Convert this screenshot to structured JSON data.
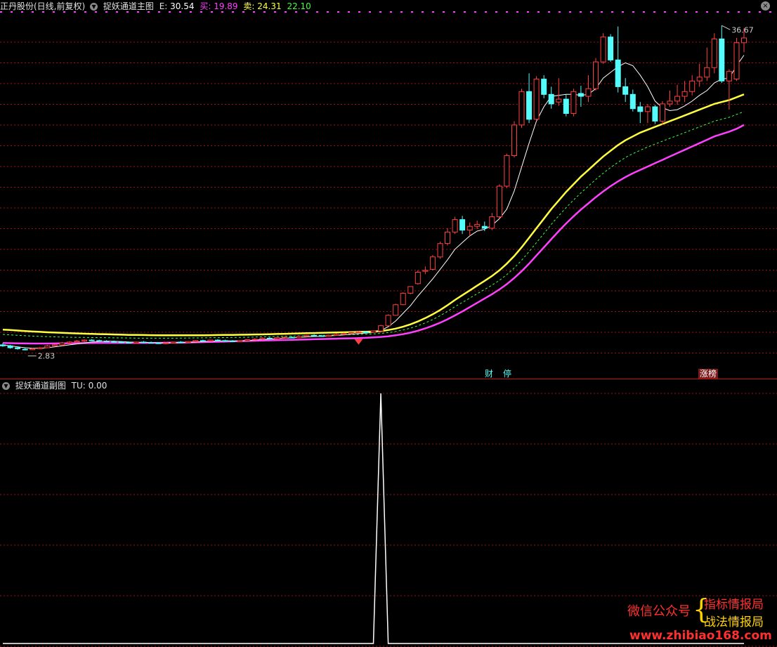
{
  "main_header": {
    "stock_title": "正丹股份(日线,前复权)",
    "indicator_name": "捉妖通道主图",
    "e_label": "E:",
    "e_value": "30.54",
    "buy_label": "买:",
    "buy_value": "19.89",
    "sell_label": "卖:",
    "sell_value": "24.31",
    "extra_value": "22.10"
  },
  "sub_header": {
    "indicator_name": "捉妖通道副图",
    "tu_label": "TU:",
    "tu_value": "0.00"
  },
  "markers": {
    "high_label": "36.67",
    "low_label": "2.83",
    "badge_cai": "财",
    "badge_ting": "停",
    "badge_zhangbang": "涨榜"
  },
  "watermark": {
    "wechat": "微信公众号",
    "line1": "指标情报局",
    "line2": "战法情报局",
    "url": "www.zhibiao168.com"
  },
  "colors": {
    "up": "#ff4040",
    "down": "#54fcfc",
    "ma_yellow": "#ffff40",
    "ma_magenta": "#ff40ff",
    "ma_green": "#40ff40",
    "grid": "#a01010",
    "e_color": "#ffffff",
    "buy_color": "#ff40ff",
    "sell_color": "#ffff40",
    "extra_color": "#40ff40"
  },
  "chart_data": [
    {
      "type": "candlestick",
      "ylim": [
        2.0,
        38.0
      ],
      "candles": [
        [
          3.4,
          3.6,
          3.2,
          3.3
        ],
        [
          3.3,
          3.4,
          3.0,
          3.1
        ],
        [
          3.1,
          3.2,
          2.9,
          3.0
        ],
        [
          2.95,
          3.05,
          2.83,
          2.9
        ],
        [
          2.9,
          3.1,
          2.85,
          3.0
        ],
        [
          3.0,
          3.2,
          2.95,
          3.1
        ],
        [
          3.1,
          3.4,
          3.05,
          3.3
        ],
        [
          3.3,
          3.5,
          3.2,
          3.4
        ],
        [
          3.4,
          3.7,
          3.3,
          3.6
        ],
        [
          3.6,
          3.8,
          3.5,
          3.7
        ],
        [
          3.7,
          3.9,
          3.6,
          3.8
        ],
        [
          3.8,
          4.0,
          3.7,
          3.9
        ],
        [
          3.9,
          4.0,
          3.8,
          3.85
        ],
        [
          3.85,
          3.95,
          3.75,
          3.8
        ],
        [
          3.8,
          3.9,
          3.7,
          3.75
        ],
        [
          3.75,
          3.85,
          3.65,
          3.7
        ],
        [
          3.7,
          3.8,
          3.6,
          3.65
        ],
        [
          3.65,
          3.75,
          3.55,
          3.6
        ],
        [
          3.6,
          3.75,
          3.55,
          3.7
        ],
        [
          3.7,
          3.8,
          3.6,
          3.65
        ],
        [
          3.65,
          3.75,
          3.55,
          3.6
        ],
        [
          3.6,
          3.7,
          3.5,
          3.55
        ],
        [
          3.55,
          3.65,
          3.45,
          3.6
        ],
        [
          3.6,
          3.75,
          3.55,
          3.7
        ],
        [
          3.7,
          3.8,
          3.6,
          3.65
        ],
        [
          3.65,
          3.8,
          3.6,
          3.75
        ],
        [
          3.75,
          3.9,
          3.7,
          3.85
        ],
        [
          3.85,
          3.95,
          3.75,
          3.8
        ],
        [
          3.8,
          3.95,
          3.75,
          3.9
        ],
        [
          3.9,
          4.0,
          3.8,
          3.85
        ],
        [
          3.85,
          3.95,
          3.75,
          3.8
        ],
        [
          3.8,
          3.9,
          3.7,
          3.75
        ],
        [
          3.75,
          3.9,
          3.7,
          3.85
        ],
        [
          3.85,
          4.0,
          3.8,
          3.95
        ],
        [
          3.95,
          4.1,
          3.9,
          4.0
        ],
        [
          4.0,
          4.2,
          3.95,
          4.1
        ],
        [
          4.1,
          4.2,
          4.0,
          4.05
        ],
        [
          4.05,
          4.2,
          4.0,
          4.15
        ],
        [
          4.15,
          4.3,
          4.1,
          4.2
        ],
        [
          4.2,
          4.3,
          4.1,
          4.15
        ],
        [
          4.15,
          4.35,
          4.1,
          4.3
        ],
        [
          4.3,
          4.45,
          4.25,
          4.4
        ],
        [
          4.4,
          4.5,
          4.3,
          4.35
        ],
        [
          4.35,
          4.45,
          4.25,
          4.3
        ],
        [
          4.3,
          4.45,
          4.25,
          4.4
        ],
        [
          4.4,
          4.6,
          4.35,
          4.5
        ],
        [
          4.5,
          4.7,
          4.45,
          4.6
        ],
        [
          4.6,
          4.75,
          4.55,
          4.7
        ],
        [
          4.7,
          4.85,
          4.6,
          4.75
        ],
        [
          4.75,
          4.85,
          4.6,
          4.7
        ],
        [
          4.7,
          4.9,
          4.65,
          4.85
        ],
        [
          4.85,
          5.5,
          4.8,
          5.4
        ],
        [
          5.4,
          6.6,
          5.35,
          6.5
        ],
        [
          6.5,
          7.7,
          6.45,
          7.6
        ],
        [
          7.6,
          8.9,
          7.55,
          8.8
        ],
        [
          8.8,
          9.5,
          8.7,
          9.5
        ],
        [
          9.8,
          11.2,
          9.7,
          11.0
        ],
        [
          11.1,
          11.6,
          10.8,
          11.2
        ],
        [
          11.3,
          12.8,
          11.2,
          12.6
        ],
        [
          12.6,
          14.2,
          12.4,
          14.0
        ],
        [
          14.0,
          15.6,
          13.8,
          15.2
        ],
        [
          15.2,
          16.8,
          15.0,
          16.5
        ],
        [
          16.5,
          16.9,
          15.0,
          15.4
        ],
        [
          15.4,
          16.2,
          14.8,
          15.8
        ],
        [
          15.8,
          16.4,
          15.5,
          16.0
        ],
        [
          15.8,
          16.3,
          15.3,
          15.6
        ],
        [
          15.6,
          17.2,
          15.4,
          16.8
        ],
        [
          16.8,
          20.2,
          16.6,
          20.0
        ],
        [
          20.0,
          23.4,
          19.8,
          23.2
        ],
        [
          23.2,
          26.8,
          23.0,
          26.4
        ],
        [
          26.4,
          30.2,
          26.1,
          29.9
        ],
        [
          29.9,
          31.8,
          26.6,
          27.0
        ],
        [
          27.0,
          31.5,
          26.8,
          31.2
        ],
        [
          31.2,
          31.6,
          29.2,
          29.6
        ],
        [
          29.6,
          30.4,
          28.1,
          28.6
        ],
        [
          28.8,
          31.3,
          28.4,
          29.1
        ],
        [
          29.1,
          29.6,
          27.3,
          27.6
        ],
        [
          27.6,
          30.2,
          27.3,
          29.9
        ],
        [
          29.7,
          30.5,
          28.3,
          29.4
        ],
        [
          29.4,
          31.6,
          28.8,
          30.2
        ],
        [
          30.2,
          33.4,
          30.0,
          33.0
        ],
        [
          33.0,
          36.0,
          32.8,
          35.6
        ],
        [
          35.6,
          35.9,
          33.0,
          33.2
        ],
        [
          33.2,
          36.7,
          29.8,
          30.4
        ],
        [
          30.4,
          31.3,
          28.8,
          29.6
        ],
        [
          29.6,
          30.1,
          27.8,
          28.1
        ],
        [
          28.3,
          28.8,
          26.6,
          27.8
        ],
        [
          27.8,
          28.6,
          26.6,
          28.3
        ],
        [
          28.3,
          28.5,
          26.5,
          26.8
        ],
        [
          26.8,
          28.9,
          26.4,
          28.6
        ],
        [
          28.6,
          30.0,
          28.3,
          28.9
        ],
        [
          28.9,
          30.6,
          28.5,
          29.4
        ],
        [
          29.4,
          31.0,
          28.8,
          29.9
        ],
        [
          29.9,
          31.6,
          29.5,
          31.0
        ],
        [
          31.0,
          32.8,
          30.4,
          31.4
        ],
        [
          31.4,
          34.5,
          31.0,
          32.4
        ],
        [
          32.4,
          36.0,
          31.8,
          35.4
        ],
        [
          35.4,
          36.8,
          30.8,
          31.0
        ],
        [
          31.0,
          32.2,
          28.0,
          32.0
        ],
        [
          31.2,
          35.5,
          31.0,
          35.0
        ],
        [
          35.0,
          36.5,
          34.0,
          35.5
        ]
      ],
      "ma_fast": [
        3.4,
        3.3,
        3.2,
        3.1,
        3.05,
        3.05,
        3.1,
        3.2,
        3.3,
        3.4,
        3.5,
        3.6,
        3.7,
        3.75,
        3.78,
        3.78,
        3.74,
        3.7,
        3.68,
        3.66,
        3.64,
        3.62,
        3.61,
        3.62,
        3.64,
        3.66,
        3.7,
        3.74,
        3.78,
        3.81,
        3.82,
        3.82,
        3.83,
        3.86,
        3.9,
        3.96,
        4.0,
        4.05,
        4.1,
        4.14,
        4.18,
        4.23,
        4.28,
        4.31,
        4.34,
        4.39,
        4.45,
        4.52,
        4.58,
        4.64,
        4.7,
        4.9,
        5.3,
        5.9,
        6.7,
        7.5,
        8.5,
        9.4,
        10.3,
        11.3,
        12.3,
        13.4,
        14.1,
        14.8,
        15.3,
        15.5,
        15.9,
        16.6,
        17.6,
        19.5,
        22.0,
        24.5,
        26.8,
        28.3,
        29.4,
        29.5,
        29.6,
        29.6,
        29.5,
        29.6,
        30.2,
        31.3,
        31.9,
        32.5,
        32.9,
        32.6,
        31.6,
        30.4,
        28.9,
        28.2,
        27.9,
        28.0,
        28.4,
        28.9,
        29.5,
        30.0,
        30.8,
        31.2,
        31.3,
        32.6,
        33.7
      ],
      "ma_yellow": [
        5.0,
        4.95,
        4.9,
        4.85,
        4.8,
        4.76,
        4.72,
        4.69,
        4.66,
        4.63,
        4.6,
        4.57,
        4.55,
        4.53,
        4.51,
        4.49,
        4.47,
        4.45,
        4.44,
        4.43,
        4.42,
        4.41,
        4.4,
        4.4,
        4.4,
        4.4,
        4.4,
        4.41,
        4.42,
        4.43,
        4.44,
        4.45,
        4.46,
        4.47,
        4.49,
        4.5,
        4.52,
        4.54,
        4.56,
        4.58,
        4.6,
        4.62,
        4.64,
        4.66,
        4.68,
        4.7,
        4.72,
        4.74,
        4.76,
        4.78,
        4.8,
        4.85,
        4.95,
        5.1,
        5.3,
        5.55,
        5.85,
        6.2,
        6.6,
        7.05,
        7.55,
        8.1,
        8.6,
        9.1,
        9.6,
        10.1,
        10.6,
        11.2,
        11.9,
        12.7,
        13.6,
        14.6,
        15.6,
        16.6,
        17.6,
        18.5,
        19.4,
        20.2,
        21.0,
        21.7,
        22.4,
        23.1,
        23.7,
        24.3,
        24.8,
        25.2,
        25.6,
        25.9,
        26.2,
        26.5,
        26.8,
        27.1,
        27.4,
        27.7,
        28.0,
        28.3,
        28.6,
        28.8,
        29.0,
        29.3,
        29.6
      ],
      "ma_green": [
        4.5,
        4.45,
        4.4,
        4.36,
        4.32,
        4.29,
        4.26,
        4.24,
        4.22,
        4.2,
        4.19,
        4.18,
        4.17,
        4.16,
        4.15,
        4.14,
        4.13,
        4.12,
        4.11,
        4.1,
        4.1,
        4.1,
        4.1,
        4.1,
        4.11,
        4.12,
        4.13,
        4.14,
        4.15,
        4.16,
        4.17,
        4.18,
        4.19,
        4.2,
        4.22,
        4.24,
        4.26,
        4.28,
        4.3,
        4.32,
        4.34,
        4.36,
        4.38,
        4.4,
        4.42,
        4.44,
        4.46,
        4.48,
        4.5,
        4.52,
        4.55,
        4.6,
        4.68,
        4.8,
        4.95,
        5.15,
        5.4,
        5.7,
        6.05,
        6.45,
        6.9,
        7.4,
        7.85,
        8.3,
        8.75,
        9.2,
        9.65,
        10.15,
        10.75,
        11.45,
        12.25,
        13.15,
        14.1,
        15.05,
        16.0,
        16.9,
        17.75,
        18.55,
        19.3,
        20.0,
        20.7,
        21.35,
        21.95,
        22.5,
        23.0,
        23.4,
        23.75,
        24.1,
        24.4,
        24.7,
        25.0,
        25.3,
        25.6,
        25.9,
        26.2,
        26.5,
        26.8,
        27.0,
        27.2,
        27.5,
        27.8
      ],
      "ma_magenta": [
        3.6,
        3.58,
        3.56,
        3.55,
        3.54,
        3.54,
        3.54,
        3.55,
        3.56,
        3.57,
        3.58,
        3.59,
        3.6,
        3.61,
        3.61,
        3.61,
        3.61,
        3.61,
        3.61,
        3.61,
        3.61,
        3.61,
        3.62,
        3.63,
        3.64,
        3.65,
        3.67,
        3.69,
        3.71,
        3.73,
        3.75,
        3.77,
        3.79,
        3.81,
        3.83,
        3.85,
        3.87,
        3.89,
        3.91,
        3.93,
        3.95,
        3.97,
        3.99,
        4.01,
        4.03,
        4.05,
        4.07,
        4.09,
        4.11,
        4.14,
        4.18,
        4.23,
        4.3,
        4.4,
        4.52,
        4.68,
        4.88,
        5.12,
        5.4,
        5.72,
        6.08,
        6.48,
        6.9,
        7.35,
        7.8,
        8.25,
        8.7,
        9.2,
        9.75,
        10.4,
        11.1,
        11.9,
        12.75,
        13.6,
        14.45,
        15.3,
        16.1,
        16.85,
        17.55,
        18.2,
        18.85,
        19.45,
        20.0,
        20.5,
        20.95,
        21.35,
        21.7,
        22.05,
        22.4,
        22.75,
        23.1,
        23.45,
        23.8,
        24.15,
        24.5,
        24.85,
        25.2,
        25.45,
        25.7,
        26.0,
        26.4
      ]
    },
    {
      "type": "line",
      "ylim": [
        0,
        1
      ],
      "x_index": [
        0,
        49,
        50,
        51,
        52,
        100
      ],
      "values": [
        0,
        0,
        0,
        1,
        0,
        0
      ]
    }
  ]
}
